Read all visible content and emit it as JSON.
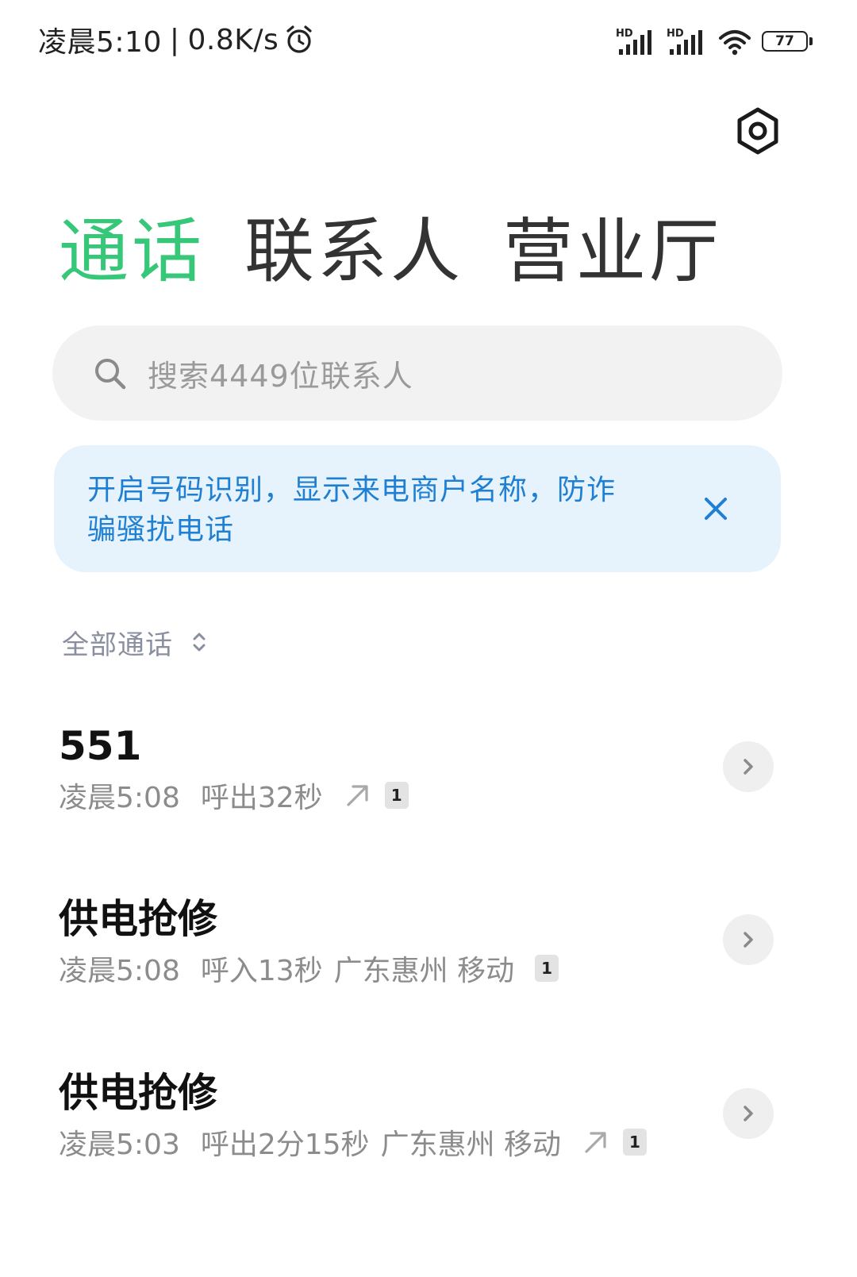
{
  "status_bar": {
    "time": "凌晨5:10",
    "separator": "|",
    "net_speed": "0.8K/s",
    "alarm_icon": "alarm-clock-icon",
    "signal_1_label": "HD",
    "signal_2_label": "HD",
    "battery_level": "77"
  },
  "header": {
    "settings_icon": "gear-icon"
  },
  "tabs": [
    {
      "label": "通话",
      "active": true
    },
    {
      "label": "联系人",
      "active": false
    },
    {
      "label": "营业厅",
      "active": false
    }
  ],
  "search": {
    "placeholder": "搜索4449位联系人"
  },
  "banner": {
    "text": "开启号码识别，显示来电商户名称，防诈骗骚扰电话",
    "close_icon": "close-icon"
  },
  "filter": {
    "label": "全部通话"
  },
  "calls": [
    {
      "name": "551",
      "time": "凌晨5:08",
      "detail": "呼出32秒",
      "location": "",
      "outgoing": true,
      "sim": "1"
    },
    {
      "name": "供电抢修",
      "time": "凌晨5:08",
      "detail": "呼入13秒",
      "location": "广东惠州 移动",
      "outgoing": false,
      "sim": "1"
    },
    {
      "name": "供电抢修",
      "time": "凌晨5:03",
      "detail": "呼出2分15秒",
      "location": "广东惠州 移动",
      "outgoing": true,
      "sim": "1"
    }
  ],
  "colors": {
    "accent": "#36c778",
    "banner_bg": "#e6f3fd",
    "banner_text": "#1f7fd2"
  }
}
